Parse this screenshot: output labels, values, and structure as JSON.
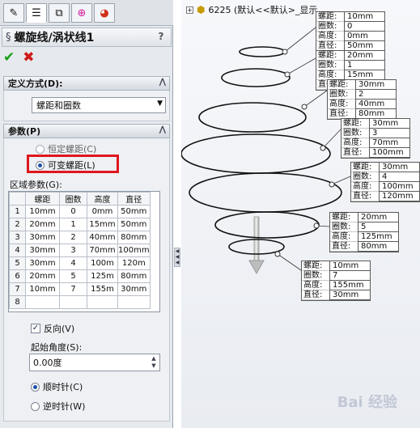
{
  "property_manager": {
    "title": "螺旋线/涡状线1",
    "help": "?",
    "tabs": [
      "feature-manager-icon",
      "property-manager-icon",
      "configuration-manager-icon",
      "dimxpert-icon",
      "display-manager-icon"
    ],
    "definition": {
      "header": "定义方式(D):",
      "selected": "螺距和圈数"
    },
    "parameters": {
      "header": "参数(P)",
      "constant_pitch": "恒定螺距(C)",
      "variable_pitch": "可变螺距(L)",
      "region_label": "区域参数(G):",
      "columns": [
        "螺距",
        "圈数",
        "高度",
        "直径"
      ],
      "rows": [
        {
          "n": "1",
          "pitch": "10mm",
          "rev": "0",
          "height": "0mm",
          "dia": "50mm"
        },
        {
          "n": "2",
          "pitch": "20mm",
          "rev": "1",
          "height": "15mm",
          "dia": "50mm"
        },
        {
          "n": "3",
          "pitch": "30mm",
          "rev": "2",
          "height": "40mm",
          "dia": "80mm"
        },
        {
          "n": "4",
          "pitch": "30mm",
          "rev": "3",
          "height": "70mm",
          "dia": "100mm"
        },
        {
          "n": "5",
          "pitch": "30mm",
          "rev": "4",
          "height": "100m",
          "dia": "120m"
        },
        {
          "n": "6",
          "pitch": "20mm",
          "rev": "5",
          "height": "125m",
          "dia": "80mm"
        },
        {
          "n": "7",
          "pitch": "10mm",
          "rev": "7",
          "height": "155m",
          "dia": "30mm"
        },
        {
          "n": "8",
          "pitch": "",
          "rev": "",
          "height": "",
          "dia": ""
        }
      ],
      "reverse_label": "反向(V)",
      "start_angle_label": "起始角度(S):",
      "start_angle_value": "0.00度",
      "clockwise": "顺时针(C)",
      "counterclockwise": "逆时针(W)"
    }
  },
  "canvas": {
    "tree_label": "6225  (默认<<默认>_显示",
    "callouts": [
      {
        "k": [
          "螺距:",
          "圈数:",
          "高度:",
          "直径:"
        ],
        "v": [
          "10mm",
          "0",
          "0mm",
          "50mm"
        ]
      },
      {
        "k": [
          "螺距:",
          "圈数:",
          "高度:",
          "直径:"
        ],
        "v": [
          "20mm",
          "1",
          "15mm",
          "50mm"
        ]
      },
      {
        "k": [
          "螺距:",
          "圈数:",
          "高度:",
          "直径:"
        ],
        "v": [
          "30mm",
          "2",
          "40mm",
          "80mm"
        ]
      },
      {
        "k": [
          "螺距:",
          "圈数:",
          "高度:",
          "直径:"
        ],
        "v": [
          "30mm",
          "3",
          "70mm",
          "100mm"
        ]
      },
      {
        "k": [
          "螺距:",
          "圈数:",
          "高度:",
          "直径:"
        ],
        "v": [
          "30mm",
          "4",
          "100mm",
          "120mm"
        ]
      },
      {
        "k": [
          "螺距:",
          "圈数:",
          "高度:",
          "直径:"
        ],
        "v": [
          "20mm",
          "5",
          "125mm",
          "80mm"
        ]
      },
      {
        "k": [
          "螺距:",
          "圈数:",
          "高度:",
          "直径:"
        ],
        "v": [
          "10mm",
          "7",
          "155mm",
          "30mm"
        ]
      }
    ],
    "watermark": "Bai 经验"
  },
  "colors": {
    "accent": "#1f4fa8",
    "highlight": "#e0161d",
    "ok": "#18a018",
    "cancel": "#d01a1a"
  }
}
